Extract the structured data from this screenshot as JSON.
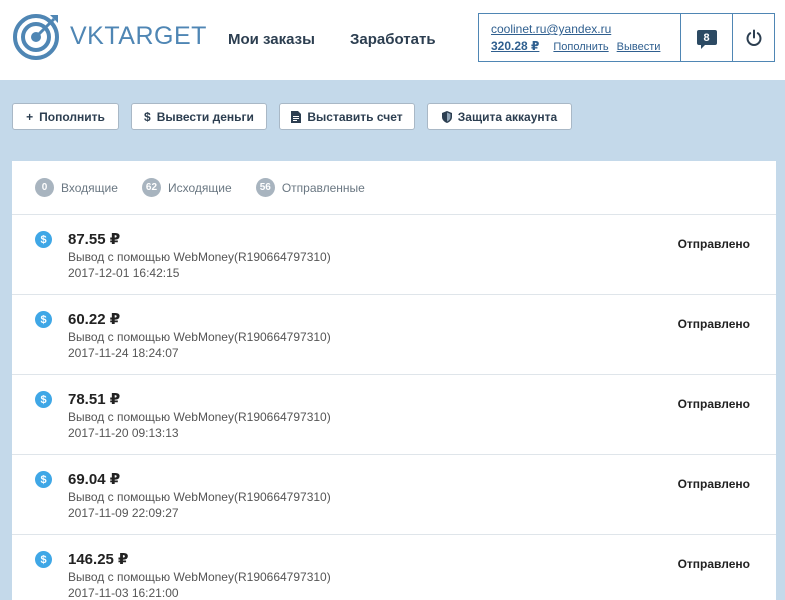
{
  "header": {
    "logo_text": "VKTARGET",
    "nav": [
      {
        "label": "Мои заказы"
      },
      {
        "label": "Заработать"
      }
    ],
    "account": {
      "email": "coolinet.ru@yandex.ru",
      "balance": "320.28 ₽",
      "topup_label": "Пополнить",
      "withdraw_label": "Вывести",
      "messages_count": "8",
      "messages_icon": "message-icon",
      "power_icon": "power-icon"
    }
  },
  "toolbar": {
    "topup": {
      "icon": "+",
      "label": "Пополнить"
    },
    "withdraw": {
      "icon": "$",
      "label": "Вывести деньги"
    },
    "invoice": {
      "icon": "document-icon",
      "label": "Выставить счет"
    },
    "protect": {
      "icon": "shield-icon",
      "label": "Защита аккаунта"
    }
  },
  "tabs": [
    {
      "count": "0",
      "label": "Входящие"
    },
    {
      "count": "62",
      "label": "Исходящие"
    },
    {
      "count": "56",
      "label": "Отправленные"
    }
  ],
  "transactions": [
    {
      "icon": "$",
      "amount": "87.55 ₽",
      "description": "Вывод с помощью WebMoney(R190664797310)",
      "date": "2017-12-01 16:42:15",
      "status": "Отправлено"
    },
    {
      "icon": "$",
      "amount": "60.22 ₽",
      "description": "Вывод с помощью WebMoney(R190664797310)",
      "date": "2017-11-24 18:24:07",
      "status": "Отправлено"
    },
    {
      "icon": "$",
      "amount": "78.51 ₽",
      "description": "Вывод с помощью WebMoney(R190664797310)",
      "date": "2017-11-20 09:13:13",
      "status": "Отправлено"
    },
    {
      "icon": "$",
      "amount": "69.04 ₽",
      "description": "Вывод с помощью WebMoney(R190664797310)",
      "date": "2017-11-09 22:09:27",
      "status": "Отправлено"
    },
    {
      "icon": "$",
      "amount": "146.25 ₽",
      "description": "Вывод с помощью WebMoney(R190664797310)",
      "date": "2017-11-03 16:21:00",
      "status": "Отправлено"
    }
  ],
  "colors": {
    "accent": "#4f86b4",
    "background": "#c4d9ea",
    "icon_blue": "#3fa7e6",
    "badge_gray": "#a8b4bf"
  }
}
